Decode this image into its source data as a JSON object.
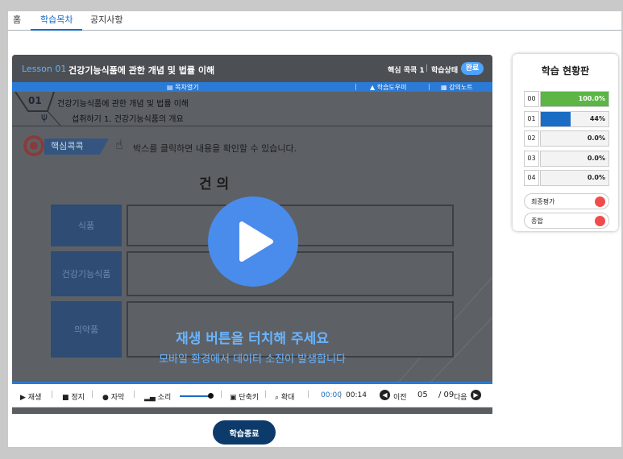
{
  "tabs": [
    {
      "label": "홈",
      "active": false
    },
    {
      "label": "학습목차",
      "active": true
    },
    {
      "label": "공지사항",
      "active": false
    }
  ],
  "player": {
    "lesson_no": "Lesson 01",
    "lesson_title": "건강기능식품에 관한 개념 및 법률 이해",
    "core_label": "핵심 콕콕 1",
    "status_label": "학습상태",
    "status_value": "완료",
    "toolbar": {
      "toc": "목차열기",
      "helper": "학습도우미",
      "notes": "강의노트"
    },
    "slide": {
      "number": "01",
      "breadcrumb1": "건강기능식품에 관한 개념 및 법률 이해",
      "breadcrumb2": "섭취하기 1. 건강기능식품의 개요",
      "core_tag": "핵심콕콕",
      "instruction": "박스를 클릭하면 내용을 확인할 수 있습니다.",
      "heading": "건                의",
      "rows": [
        "식품",
        "건강기능식품",
        "의약품"
      ]
    },
    "overlay": {
      "msg1": "재생 버튼을 터치해 주세요",
      "msg2": "모바일 환경에서 데이터 소진이 발생합니다"
    },
    "controls": {
      "play": "재생",
      "stop": "정지",
      "caption": "자막",
      "sound": "소리",
      "shortcut": "단축키",
      "zoom": "확대",
      "time_current": "00:00",
      "time_total": "00:14",
      "prev": "이전",
      "page_current": "05",
      "page_total": "/ 09",
      "next": "다음",
      "volume": 0.85
    }
  },
  "finish_button": "학습종료",
  "dashboard": {
    "title": "학습 현황판",
    "rows": [
      {
        "num": "00",
        "pct": "100.0%",
        "fraction": 1.0,
        "color": "#5cb545"
      },
      {
        "num": "01",
        "pct": "44%",
        "fraction": 0.44,
        "color": "#1a6cc4"
      },
      {
        "num": "02",
        "pct": "0.0%",
        "fraction": 0,
        "color": "#1a6cc4"
      },
      {
        "num": "03",
        "pct": "0.0%",
        "fraction": 0,
        "color": "#1a6cc4"
      },
      {
        "num": "04",
        "pct": "0.0%",
        "fraction": 0,
        "color": "#1a6cc4"
      }
    ],
    "final_eval": "최종평가",
    "total": "종합",
    "dot_color": "#f24b4b"
  }
}
